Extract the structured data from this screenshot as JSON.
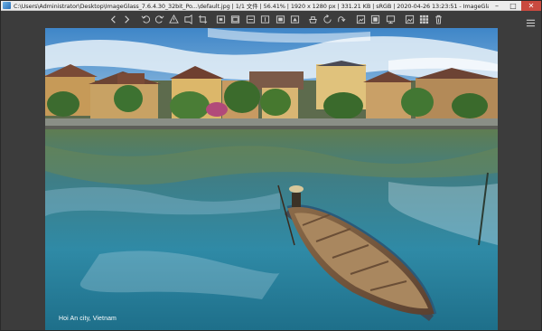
{
  "window": {
    "title": "C:\\Users\\Administrator\\Desktop\\ImageGlass_7.6.4.30_32bit_Po...\\default.jpg  |  1/1 文件  |  56.41%  |  1920 x 1280 px  |  331.21 KB  |  sRGB  |  2020-04-26 13:23:51  -  ImageGlass",
    "minimize": "–",
    "maximize": "□",
    "close": "✕"
  },
  "toolbar": {
    "icons": [
      "previous-icon",
      "next-icon",
      "rotate-left-icon",
      "rotate-right-icon",
      "flip-horizontal-icon",
      "flip-vertical-icon",
      "crop-icon",
      "auto-zoom-icon",
      "lock-zoom-icon",
      "scale-width-icon",
      "scale-height-icon",
      "window-fit-icon",
      "lock-ratio-icon",
      "refresh-icon",
      "goto-icon",
      "thumbnail-icon",
      "checkerboard-icon",
      "fullscreen-icon",
      "slideshow-icon",
      "delete-icon",
      "menu-icon"
    ]
  },
  "image": {
    "caption": "Hoi An city, Vietnam"
  }
}
